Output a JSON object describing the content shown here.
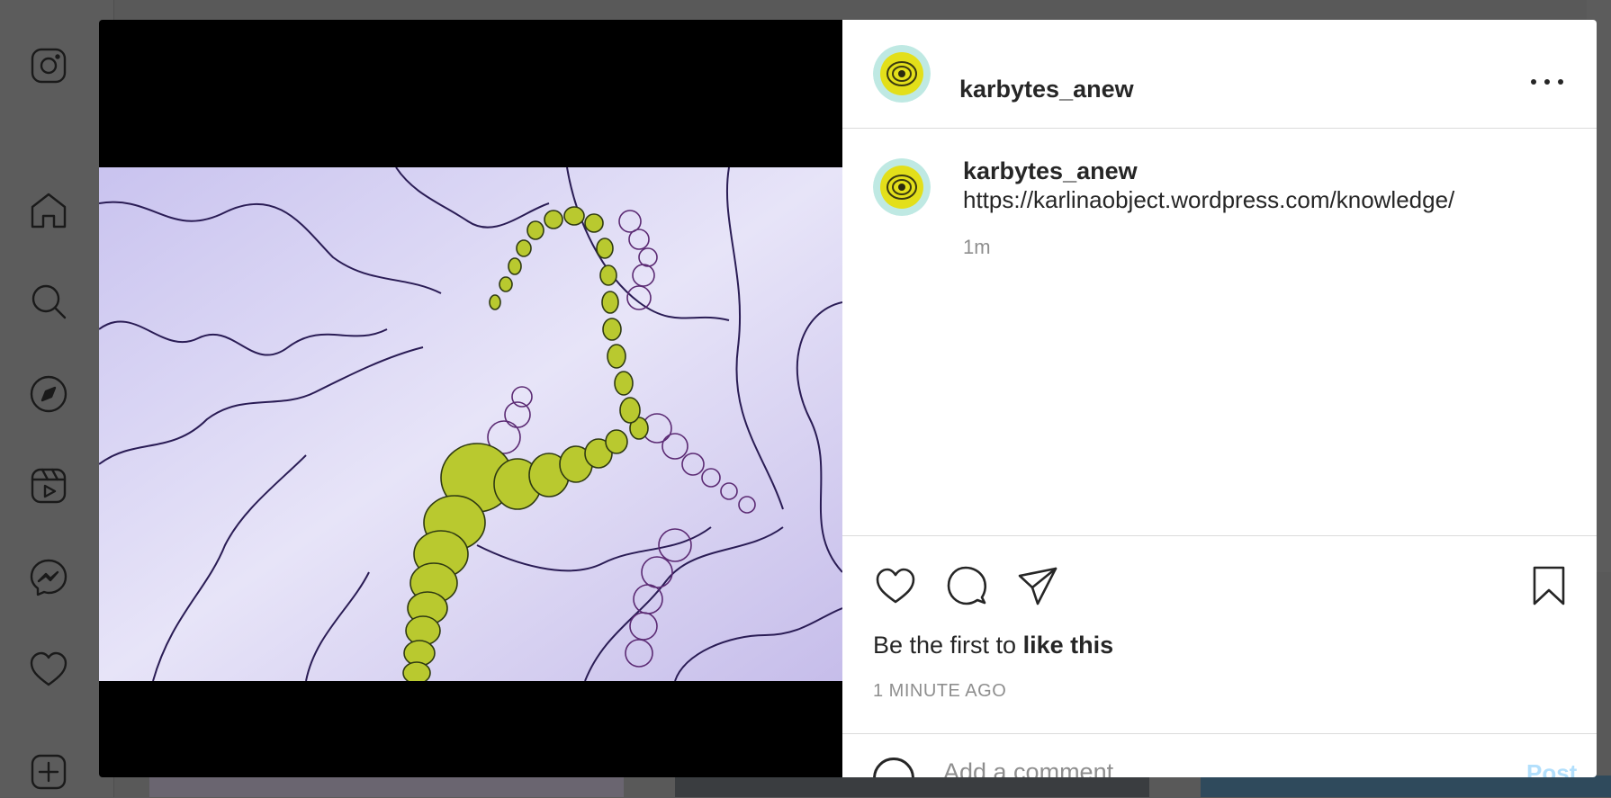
{
  "sidebar": {
    "items": [
      {
        "icon": "instagram-logo-icon"
      },
      {
        "icon": "home-icon"
      },
      {
        "icon": "search-icon"
      },
      {
        "icon": "explore-icon"
      },
      {
        "icon": "reels-icon"
      },
      {
        "icon": "messenger-icon"
      },
      {
        "icon": "heart-icon"
      },
      {
        "icon": "create-icon"
      }
    ]
  },
  "post": {
    "author": "karbytes_anew",
    "caption_author": "karbytes_anew",
    "caption": "https://karlinaobject.wordpress.com/knowledge/",
    "relative_time": "1m",
    "likes_prefix": "Be the first to ",
    "likes_action": "like this",
    "timestamp": "1 MINUTE AGO",
    "comment_placeholder": "Add a comment…",
    "post_label": "Post"
  },
  "colors": {
    "accent_post": "#b2dffc",
    "backdrop": "#595959"
  }
}
